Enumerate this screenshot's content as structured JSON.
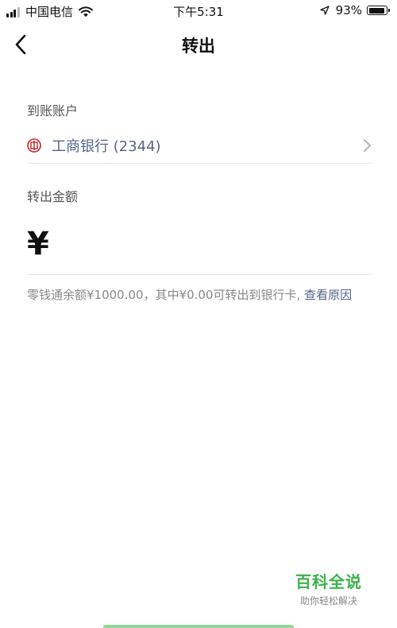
{
  "status_bar": {
    "carrier": "中国电信",
    "time": "下午5:31",
    "battery": "93%"
  },
  "nav": {
    "title": "转出"
  },
  "form": {
    "account_label": "到账账户",
    "bank_name": "工商银行 (2344)",
    "amount_label": "转出金额",
    "currency_symbol": "¥",
    "note_text": "零钱通余额¥1000.00，其中¥0.00可转出到银行卡, ",
    "note_link": "查看原因"
  },
  "watermark": {
    "title": "百科全说",
    "subtitle": "助你轻松解决"
  },
  "colors": {
    "link": "#56648a",
    "bank_logo": "#c0272d",
    "watermark": "#39b34a"
  }
}
